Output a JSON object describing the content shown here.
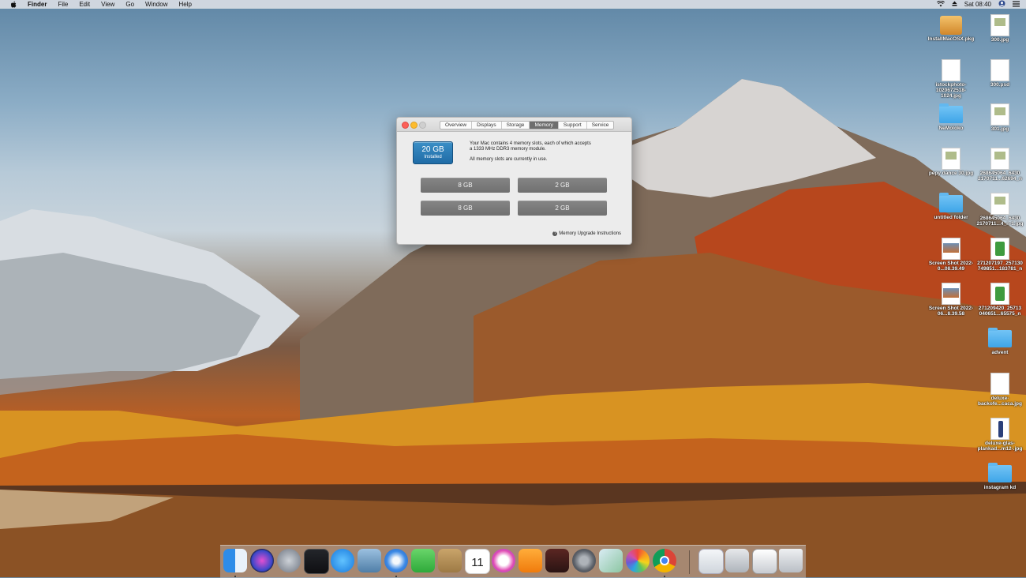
{
  "menubar": {
    "items": [
      "Finder",
      "File",
      "Edit",
      "View",
      "Go",
      "Window",
      "Help"
    ],
    "clock": "Sat 08:40"
  },
  "window": {
    "tabs": [
      "Overview",
      "Displays",
      "Storage",
      "Memory",
      "Support",
      "Service"
    ],
    "active_tab": "Memory",
    "badge_amount": "20 GB",
    "badge_caption": "Installed",
    "description_line1": "Your Mac contains 4 memory slots, each of which accepts",
    "description_line2": "a 1333 MHz DDR3 memory module.",
    "description_line3": "All memory slots are currently in use.",
    "slots": [
      "8 GB",
      "2 GB",
      "8 GB",
      "2 GB"
    ],
    "instructions_link": "Memory Upgrade Instructions"
  },
  "desktop_icons": [
    {
      "label": "InstallMacOSX.pkg",
      "kind": "package"
    },
    {
      "label": "300.jpg",
      "kind": "tagged"
    },
    {
      "label": "istockphoto-1020672518-1024.jpg",
      "kind": "doc"
    },
    {
      "label": "300.psd",
      "kind": "doc"
    },
    {
      "label": "NeMoloko",
      "kind": "folder"
    },
    {
      "label": "301.jpg",
      "kind": "tagged"
    },
    {
      "label": "pepy dance 30.jpg",
      "kind": "tagged"
    },
    {
      "label": "268645064_6430 2170711...62694_n",
      "kind": "tagged"
    },
    {
      "label": "untitled folder",
      "kind": "folder"
    },
    {
      "label": "268645064_6430 2170711...4_n-1.jpg",
      "kind": "tagged"
    },
    {
      "label": "Screen Shot 2022-0...08.39.49",
      "kind": "shot"
    },
    {
      "label": "271207197_257130 749851...183781_n",
      "kind": "green"
    },
    {
      "label": "Screen Shot 2022-06...8.39.58",
      "kind": "shot"
    },
    {
      "label": "271209420_25713 040651...65575_n",
      "kind": "green"
    },
    {
      "label": "advent",
      "kind": "folder"
    },
    {
      "label": "deluxe-backofe...caca.jpg",
      "kind": "doc"
    },
    {
      "label": "deluxe-glas-plankad...m12-.jpg",
      "kind": "bottle"
    },
    {
      "label": "instagram kd",
      "kind": "folder"
    }
  ],
  "dock": {
    "apps": [
      "finder-icon",
      "siri-icon",
      "launchpad-icon",
      "photo-booth-icon",
      "app-store-icon",
      "preview-icon",
      "safari-icon",
      "facetime-icon",
      "notes-icon",
      "calendar-icon",
      "itunes-icon",
      "books-icon",
      "photo-slideshow-icon",
      "system-preferences-icon",
      "maps-icon",
      "photos-icon",
      "chrome-icon"
    ],
    "calendar_day": "11",
    "right_items": [
      "documents-stack-icon",
      "downloads-stack-icon",
      "screenshot-stack-icon",
      "trash-icon"
    ]
  },
  "colors": {
    "menubar": "#e8e8ec",
    "active_tab": "#6e6e6e",
    "badge": "#2a7ab8",
    "slot": "#7a7a7a",
    "folder": "#4fb0ee"
  }
}
